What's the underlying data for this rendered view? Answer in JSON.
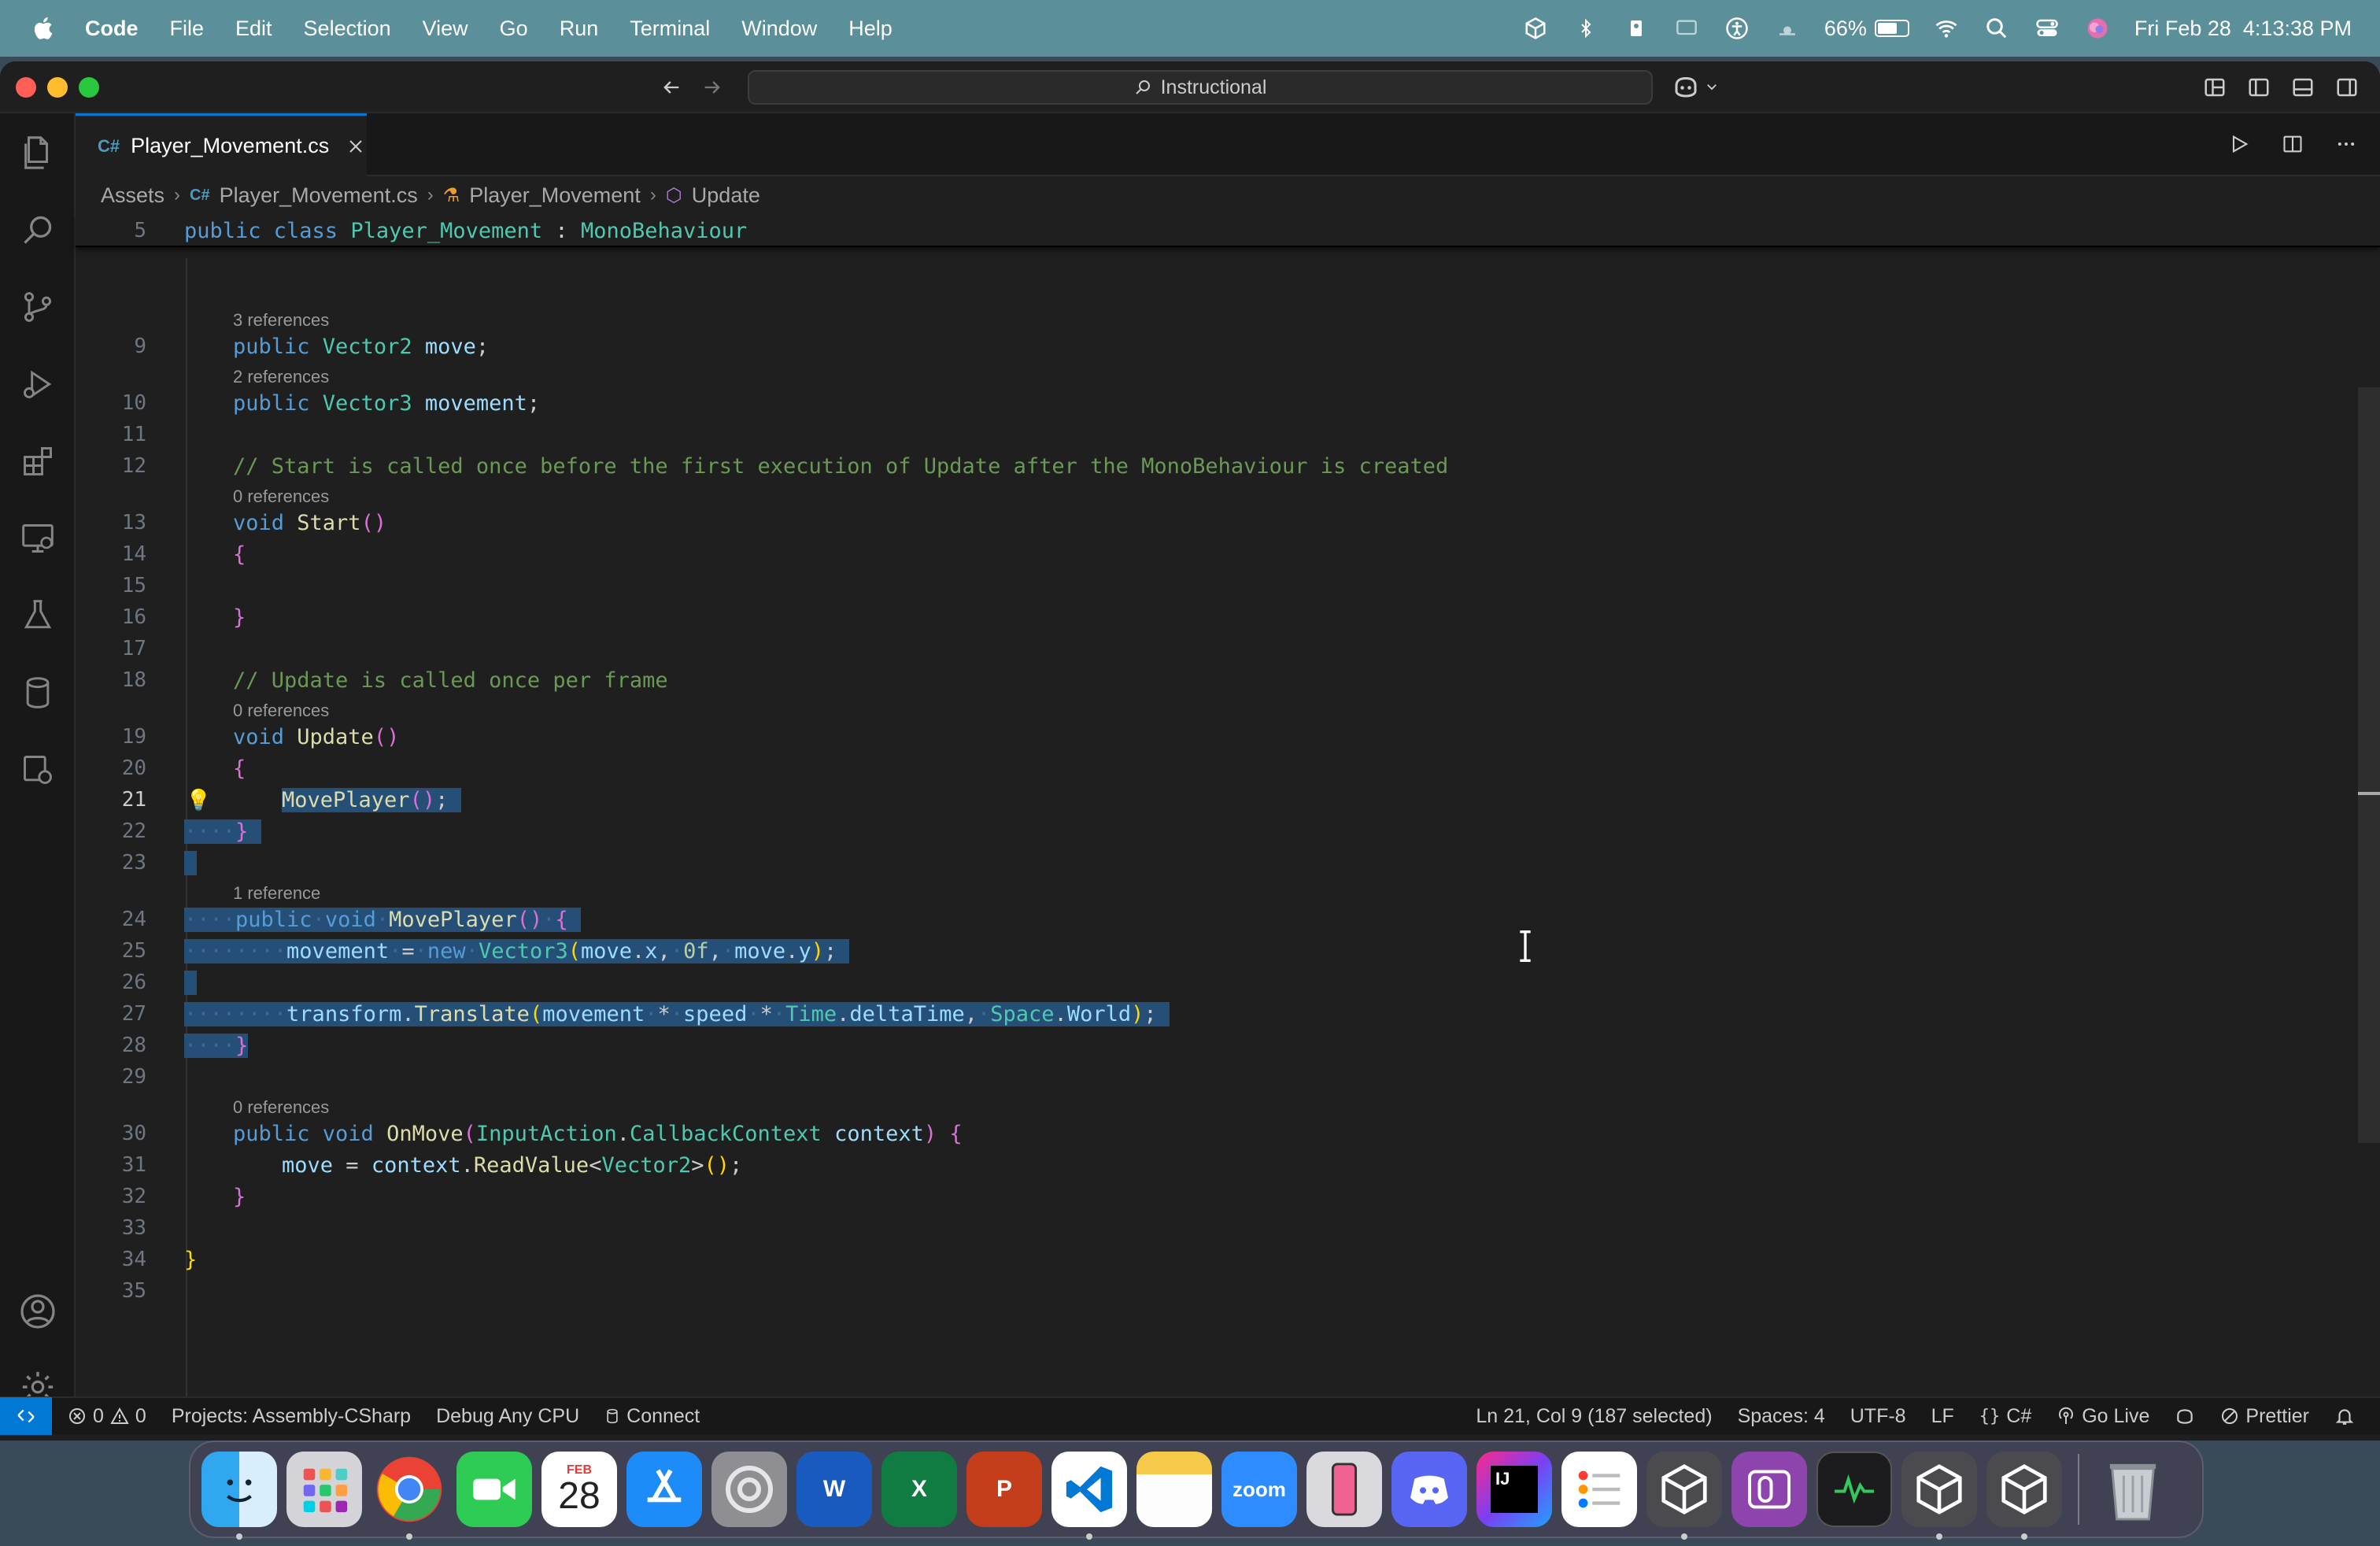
{
  "menubar": {
    "app_name": "Code",
    "items": [
      "File",
      "Edit",
      "Selection",
      "View",
      "Go",
      "Run",
      "Terminal",
      "Window",
      "Help"
    ],
    "battery_percent": "66%",
    "battery_level": 0.66,
    "datetime": "Fri Feb 28  4:13:38 PM"
  },
  "titlebar": {
    "search_text": "Instructional"
  },
  "tab": {
    "filename": "Player_Movement.cs",
    "icon_label": "C#"
  },
  "breadcrumb": {
    "items": [
      "Assets",
      "Player_Movement.cs",
      "Player_Movement",
      "Update"
    ]
  },
  "editor": {
    "sticky_line_number": "5",
    "lenses": {
      "l9": "3 references",
      "l10": "2 references",
      "l13": "0 references",
      "l19": "0 references",
      "l24": "1 reference",
      "l30": "0 references"
    },
    "line_numbers": [
      "9",
      "10",
      "11",
      "12",
      "13",
      "14",
      "15",
      "16",
      "17",
      "18",
      "19",
      "20",
      "21",
      "22",
      "23",
      "24",
      "25",
      "26",
      "27",
      "28",
      "29",
      "30",
      "31",
      "32",
      "33",
      "34",
      "35"
    ]
  },
  "statusbar": {
    "errors": "0",
    "warnings": "0",
    "projects": "Projects: Assembly-CSharp",
    "debug": "Debug Any CPU",
    "connect": "Connect",
    "position": "Ln 21, Col 9 (187 selected)",
    "spaces": "Spaces: 4",
    "encoding": "UTF-8",
    "eol": "LF",
    "language": "C#",
    "golive": "Go Live",
    "prettier": "Prettier"
  },
  "dock": {
    "calendar_month": "FEB",
    "calendar_day": "28",
    "zoom_label": "zoom",
    "ij_label": "IJ"
  }
}
